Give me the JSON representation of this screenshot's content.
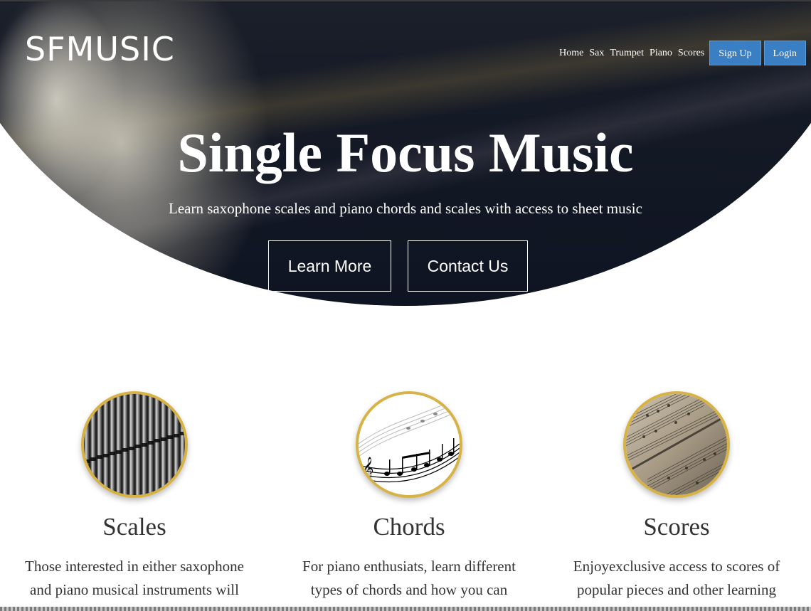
{
  "brand": {
    "logo": "SFMUSIC"
  },
  "nav": {
    "links": [
      "Home",
      "Sax",
      "Trumpet",
      "Piano",
      "Scores"
    ],
    "signup_label": "Sign Up",
    "login_label": "Login",
    "button_color": "#3a7fc4"
  },
  "hero": {
    "title": "Single Focus Music",
    "subtitle": "Learn saxophone scales and piano chords and scales with access to sheet music",
    "learn_more_label": "Learn More",
    "contact_label": "Contact Us"
  },
  "features": [
    {
      "title": "Scales",
      "text": "Those interested in either saxophone and piano musical instruments will",
      "image_icon": "organ-pipes-icon"
    },
    {
      "title": "Chords",
      "text": "For piano enthusiats, learn different types of chords and how you can",
      "image_icon": "music-notes-icon"
    },
    {
      "title": "Scores",
      "text": "Enjoyexclusive access to scores of popular pieces and other learning",
      "image_icon": "sheet-music-icon"
    }
  ],
  "colors": {
    "accent_ring": "#d7b245",
    "hero_dark": "#151a26",
    "text": "#333333"
  }
}
